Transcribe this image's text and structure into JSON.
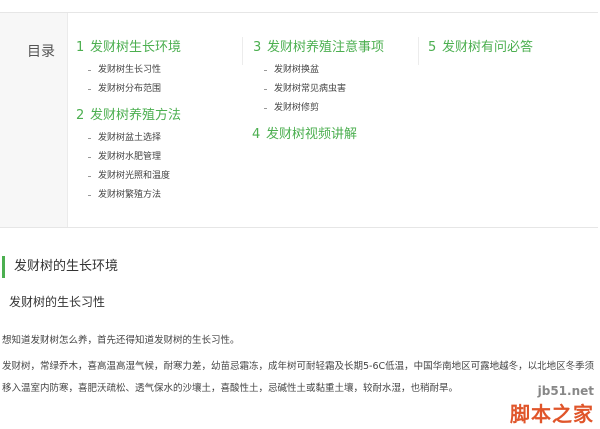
{
  "toc": {
    "label": "目录",
    "sections": [
      {
        "num": "1",
        "title": "发财树生长环境",
        "items": [
          "发财树生长习性",
          "发财树分布范围"
        ]
      },
      {
        "num": "2",
        "title": "发财树养殖方法",
        "items": [
          "发财树盆土选择",
          "发财树水肥管理",
          "发财树光照和温度",
          "发财树繁殖方法"
        ]
      },
      {
        "num": "3",
        "title": "发财树养殖注意事项",
        "items": [
          "发财树换盆",
          "发财树常见病虫害",
          "发财树修剪"
        ]
      },
      {
        "num": "4",
        "title": "发财树视频讲解",
        "items": []
      },
      {
        "num": "5",
        "title": "发财树有问必答",
        "items": []
      }
    ]
  },
  "article": {
    "heading": "发财树的生长环境",
    "subheading": "发财树的生长习性",
    "para1": "想知道发财树怎么养，首先还得知道发财树的生长习性。",
    "para2": "发财树，常绿乔木，喜高温高湿气候，耐寒力差，幼苗忌霜冻，成年树可耐轻霜及长期5-6C低温，中国华南地区可露地越冬，以北地区冬季须移入温室内防寒，喜肥沃疏松、透气保水的沙壤土，喜酸性土，忌碱性土或黏重土壤，较耐水湿，也稍耐旱。"
  },
  "watermark": {
    "url": "jb51.net",
    "name": "脚本之家"
  },
  "colors": {
    "accent": "#4caf50",
    "watermark": "#e0552a"
  }
}
